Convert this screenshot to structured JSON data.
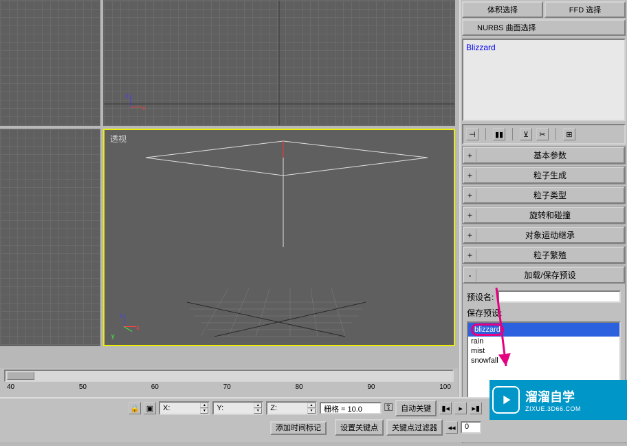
{
  "top_buttons": {
    "vol_select": "体积选择",
    "ffd_select": "FFD 选择",
    "nurbs_surf": "NURBS 曲面选择"
  },
  "object_name": "Blizzard",
  "viewport": {
    "persp_label": "透视",
    "axis_x": "x",
    "axis_y": "y",
    "axis_z": "z"
  },
  "rollouts": [
    {
      "sign": "+",
      "title": "基本参数"
    },
    {
      "sign": "+",
      "title": "粒子生成"
    },
    {
      "sign": "+",
      "title": "粒子类型"
    },
    {
      "sign": "+",
      "title": "旋转和碰撞"
    },
    {
      "sign": "+",
      "title": "对象运动继承"
    },
    {
      "sign": "+",
      "title": "粒子繁殖"
    },
    {
      "sign": "-",
      "title": "加载/保存预设"
    }
  ],
  "preset_panel": {
    "name_label": "预设名:",
    "name_value": "",
    "save_label": "保存预设:",
    "items": [
      "blizzard",
      "rain",
      "mist",
      "snowfall"
    ],
    "selected": "blizzard"
  },
  "timeline": {
    "ticks": [
      "40",
      "50",
      "60",
      "70",
      "80",
      "90",
      "100"
    ]
  },
  "status": {
    "lock_icon": "🔒",
    "x_label": "X:",
    "y_label": "Y:",
    "z_label": "Z:",
    "grid_label": "栅格 = 10.0",
    "auto_key": "自动关键",
    "set_key": "设置关键点",
    "key_filter": "关键点过滤器",
    "add_time_tag": "添加时间标记"
  },
  "watermark": {
    "title": "溜溜自学",
    "url": "ZIXUE.3D66.COM"
  }
}
